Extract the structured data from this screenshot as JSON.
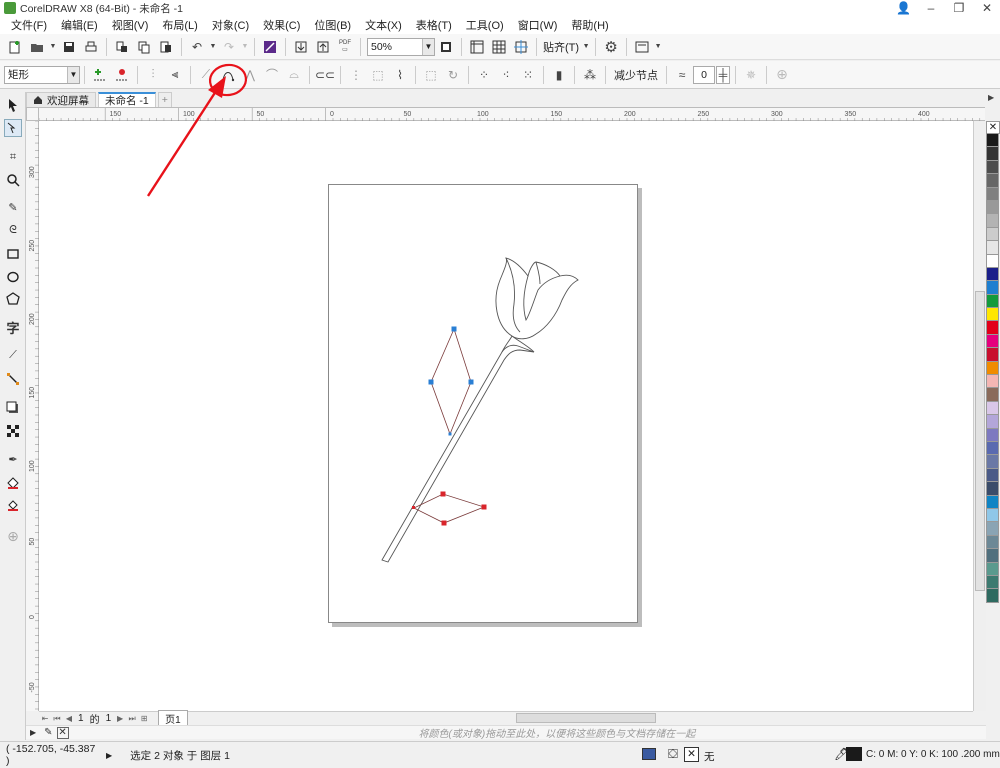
{
  "window": {
    "title": "CorelDRAW X8 (64-Bit) - 未命名 -1"
  },
  "menu": [
    "文件(F)",
    "编辑(E)",
    "视图(V)",
    "布局(L)",
    "对象(C)",
    "效果(C)",
    "位图(B)",
    "文本(X)",
    "表格(T)",
    "工具(O)",
    "窗口(W)",
    "帮助(H)"
  ],
  "toolbar": {
    "zoom_value": "50%",
    "snap_label": "贴齐(T)",
    "pdf_label": "PDF"
  },
  "propbar": {
    "shape_select": "矩形",
    "reduce_nodes_label": "减少节点",
    "smooth_value": "0"
  },
  "tabs": [
    {
      "label": "欢迎屏幕",
      "active": false
    },
    {
      "label": "未命名 -1",
      "active": true
    }
  ],
  "ruler": {
    "h_labels": [
      "150",
      "100",
      "50",
      "0",
      "50",
      "100",
      "150",
      "200",
      "250",
      "300",
      "350",
      "400"
    ],
    "v_labels": [
      "300",
      "250",
      "200",
      "150",
      "100",
      "50",
      "0",
      "-50"
    ],
    "unit": "毫米"
  },
  "pagenav": {
    "current": "1",
    "of_label": "的",
    "total": "1",
    "page_tab": "页1"
  },
  "docbar": {
    "hint": "将颜色(或对象)拖动至此处，以便将这些颜色与文档存储在一起"
  },
  "status": {
    "coords": "( -152.705, -45.387 )",
    "selection": "选定 2 对象 于 图层 1",
    "fill_label": "无",
    "outline_info": "C: 0 M: 0 Y: 0 K: 100  .200 mm"
  },
  "palette_colors": [
    "#1a1a1a",
    "#333333",
    "#4d4d4d",
    "#666666",
    "#808080",
    "#999999",
    "#b3b3b3",
    "#cccccc",
    "#e6e6e6",
    "#ffffff",
    "#1b1f8a",
    "#1e7fd0",
    "#139a3c",
    "#ffe600",
    "#e2001a",
    "#e5007d",
    "#c8102e",
    "#f08c00",
    "#f4b6b3",
    "#8a6a5a",
    "#d9c7e8",
    "#b3a6d9",
    "#7d79c0",
    "#5a6ab0",
    "#6a78a6",
    "#4a5a88",
    "#3a4c6a",
    "#0f84c4",
    "#8fc7e8",
    "#8aa4b4",
    "#6c8896",
    "#50707e",
    "#5a9a8e",
    "#3c7a70",
    "#2e6a60"
  ],
  "colors": {
    "accent": "#3a8fd8",
    "annotation": "#e8121a",
    "node_blue": "#2a7fd4",
    "node_red": "#d9242b"
  }
}
